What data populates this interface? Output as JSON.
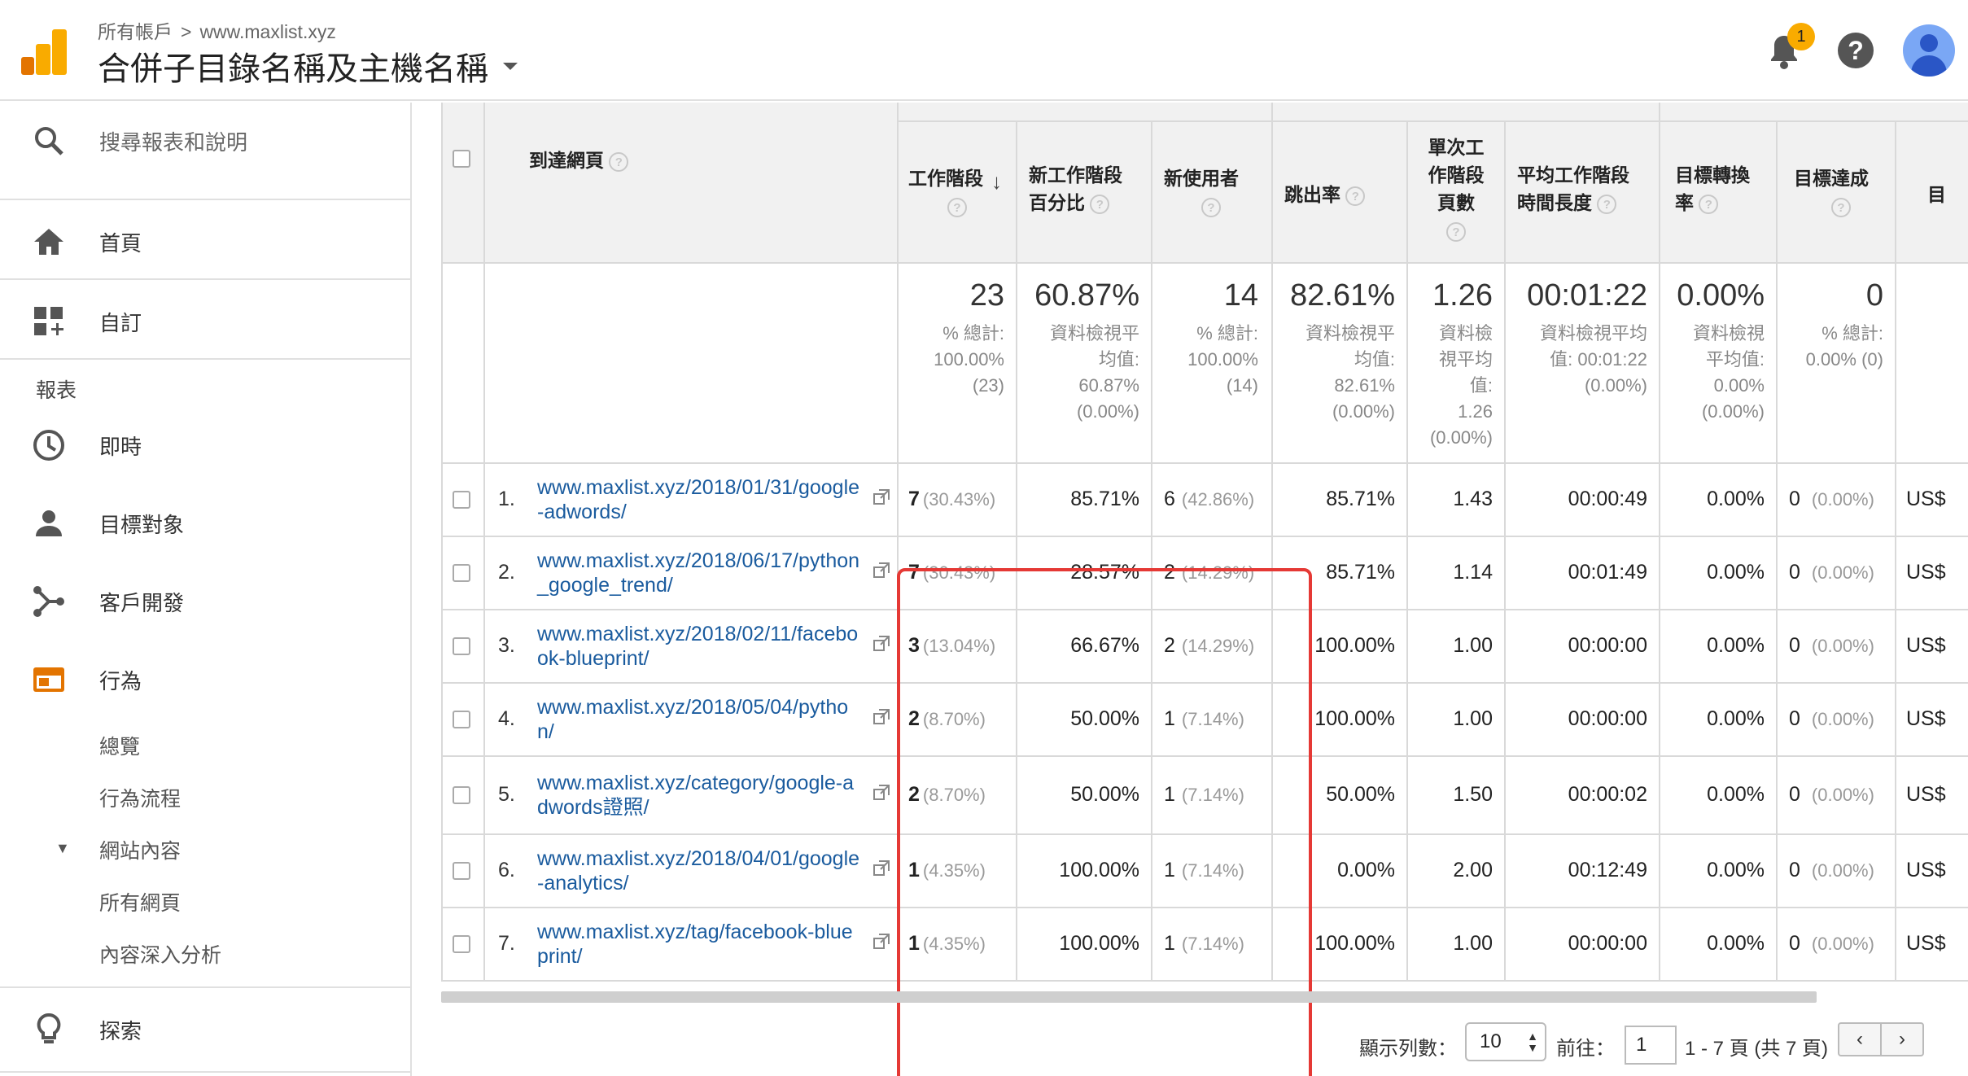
{
  "header": {
    "breadcrumb_root": "所有帳戶",
    "breadcrumb_sep": ">",
    "breadcrumb_property": "www.maxlist.xyz",
    "view_title": "合併子目錄名稱及主機名稱",
    "notification_count": "1",
    "help_label": "?"
  },
  "sidebar": {
    "search_placeholder": "搜尋報表和說明",
    "home": "首頁",
    "customization": "自訂",
    "section_reports": "報表",
    "realtime": "即時",
    "audience": "目標對象",
    "acquisition": "客戶開發",
    "behavior": "行為",
    "behavior_sub": {
      "overview": "總覽",
      "behavior_flow": "行為流程",
      "site_content": "網站內容",
      "all_pages": "所有網頁",
      "content_drilldown": "內容深入分析"
    },
    "discover": "探索"
  },
  "table": {
    "dimension_header": "到達網頁",
    "columns": {
      "sessions": "工作階段",
      "new_sessions_pct_l1": "新工作階段",
      "new_sessions_pct_l2": "百分比",
      "new_users": "新使用者",
      "bounce_rate": "跳出率",
      "pages_session_l1": "單次工",
      "pages_session_l2": "作階段",
      "pages_session_l3": "頁數",
      "avg_duration_l1": "平均工作階段",
      "avg_duration_l2": "時間長度",
      "goal_conv_l1": "目標轉換",
      "goal_conv_l2": "率",
      "goal_completions": "目標達成",
      "goal_value_partial": "目"
    },
    "totals": {
      "sessions": {
        "big": "23",
        "sub": [
          "% 總計:",
          "100.00%",
          "(23)"
        ]
      },
      "new_sessions_pct": {
        "big": "60.87%",
        "sub": [
          "資料檢視平",
          "均值:",
          "60.87%",
          "(0.00%)"
        ]
      },
      "new_users": {
        "big": "14",
        "sub": [
          "% 總計:",
          "100.00%",
          "(14)"
        ]
      },
      "bounce_rate": {
        "big": "82.61%",
        "sub": [
          "資料檢視平",
          "均值:",
          "82.61%",
          "(0.00%)"
        ]
      },
      "pages_session": {
        "big": "1.26",
        "sub": [
          "資料檢",
          "視平均",
          "值:",
          "1.26",
          "(0.00%)"
        ]
      },
      "avg_duration": {
        "big": "00:01:22",
        "sub": [
          "資料檢視平均",
          "值: 00:01:22",
          "(0.00%)"
        ]
      },
      "goal_conv": {
        "big": "0.00%",
        "sub": [
          "資料檢視",
          "平均值:",
          "0.00%",
          "(0.00%)"
        ]
      },
      "goal_completions": {
        "big": "0",
        "sub": [
          "% 總計:",
          "0.00% (0)"
        ]
      }
    },
    "rows": [
      {
        "num": "1.",
        "url": "www.maxlist.xyz/2018/01/31/google-adwords/",
        "sessions": "7",
        "sessions_pct": "(30.43%)",
        "new_pct": "85.71%",
        "new_users": "6",
        "new_users_pct": "(42.86%)",
        "bounce": "85.71%",
        "pps": "1.43",
        "dur": "00:00:49",
        "conv": "0.00%",
        "goal": "0",
        "goal_pct": "(0.00%)",
        "value": "US$"
      },
      {
        "num": "2.",
        "url": "www.maxlist.xyz/2018/06/17/python_google_trend/",
        "sessions": "7",
        "sessions_pct": "(30.43%)",
        "new_pct": "28.57%",
        "new_users": "2",
        "new_users_pct": "(14.29%)",
        "bounce": "85.71%",
        "pps": "1.14",
        "dur": "00:01:49",
        "conv": "0.00%",
        "goal": "0",
        "goal_pct": "(0.00%)",
        "value": "US$"
      },
      {
        "num": "3.",
        "url": "www.maxlist.xyz/2018/02/11/facebook-blueprint/",
        "sessions": "3",
        "sessions_pct": "(13.04%)",
        "new_pct": "66.67%",
        "new_users": "2",
        "new_users_pct": "(14.29%)",
        "bounce": "100.00%",
        "pps": "1.00",
        "dur": "00:00:00",
        "conv": "0.00%",
        "goal": "0",
        "goal_pct": "(0.00%)",
        "value": "US$"
      },
      {
        "num": "4.",
        "url": "www.maxlist.xyz/2018/05/04/python/",
        "sessions": "2",
        "sessions_pct": "(8.70%)",
        "new_pct": "50.00%",
        "new_users": "1",
        "new_users_pct": "(7.14%)",
        "bounce": "100.00%",
        "pps": "1.00",
        "dur": "00:00:00",
        "conv": "0.00%",
        "goal": "0",
        "goal_pct": "(0.00%)",
        "value": "US$"
      },
      {
        "num": "5.",
        "url": "www.maxlist.xyz/category/google-adwords證照/",
        "sessions": "2",
        "sessions_pct": "(8.70%)",
        "new_pct": "50.00%",
        "new_users": "1",
        "new_users_pct": "(7.14%)",
        "bounce": "50.00%",
        "pps": "1.50",
        "dur": "00:00:02",
        "conv": "0.00%",
        "goal": "0",
        "goal_pct": "(0.00%)",
        "value": "US$"
      },
      {
        "num": "6.",
        "url": "www.maxlist.xyz/2018/04/01/google-analytics/",
        "sessions": "1",
        "sessions_pct": "(4.35%)",
        "new_pct": "100.00%",
        "new_users": "1",
        "new_users_pct": "(7.14%)",
        "bounce": "0.00%",
        "pps": "2.00",
        "dur": "00:12:49",
        "conv": "0.00%",
        "goal": "0",
        "goal_pct": "(0.00%)",
        "value": "US$"
      },
      {
        "num": "7.",
        "url": "www.maxlist.xyz/tag/facebook-blueprint/",
        "sessions": "1",
        "sessions_pct": "(4.35%)",
        "new_pct": "100.00%",
        "new_users": "1",
        "new_users_pct": "(7.14%)",
        "bounce": "100.00%",
        "pps": "1.00",
        "dur": "00:00:00",
        "conv": "0.00%",
        "goal": "0",
        "goal_pct": "(0.00%)",
        "value": "US$"
      }
    ]
  },
  "pagination": {
    "rows_label": "顯示列數：",
    "rows_value": "10",
    "goto_label": "前往：",
    "goto_value": "1",
    "range_text": "1 - 7 頁 (共 7 頁)",
    "prev": "‹",
    "next": "›"
  },
  "colors": {
    "accent_orange": "#f9ab00",
    "link_blue": "#1a5b9e",
    "highlight_red": "#e53935",
    "header_bg": "#f1f1f1"
  }
}
